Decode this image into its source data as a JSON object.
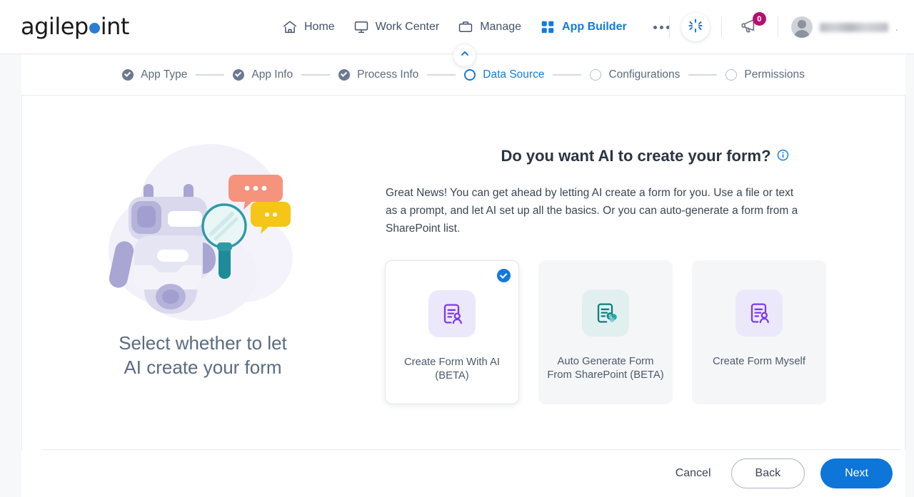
{
  "brand": {
    "name_part1": "agilep",
    "dot": "o",
    "name_part2": "int"
  },
  "nav": {
    "items": [
      {
        "label": "Home",
        "icon": "home-icon",
        "active": false
      },
      {
        "label": "Work Center",
        "icon": "monitor-icon",
        "active": false
      },
      {
        "label": "Manage",
        "icon": "briefcase-icon",
        "active": false
      },
      {
        "label": "App Builder",
        "icon": "grid-icon",
        "active": true
      }
    ],
    "overflow_icon": "ellipsis-icon"
  },
  "header_right": {
    "ai_icon": "ai-pinwheel-icon",
    "announcements_icon": "megaphone-icon",
    "announcements_count": "0",
    "avatar_icon": "avatar-icon",
    "user_name": "",
    "user_name_redacted": true,
    "caret": "."
  },
  "collapse_toggle": {
    "icon": "chevron-up-icon"
  },
  "stepper": {
    "steps": [
      {
        "label": "App Type",
        "state": "done"
      },
      {
        "label": "App Info",
        "state": "done"
      },
      {
        "label": "Process Info",
        "state": "done"
      },
      {
        "label": "Data Source",
        "state": "active"
      },
      {
        "label": "Configurations",
        "state": "todo"
      },
      {
        "label": "Permissions",
        "state": "todo"
      }
    ]
  },
  "left_panel": {
    "illustration": "robot-with-magnifier-illustration",
    "caption_line1": "Select whether to let",
    "caption_line2": "AI create your form"
  },
  "main": {
    "title": "Do you want AI to create your form?",
    "info_icon": "info-icon",
    "description": "Great News! You can get ahead by letting AI create a form for you. Use a file or text as a prompt, and let AI set up all the basics. Or you can auto-generate a form from a SharePoint list.",
    "options": [
      {
        "label_line1": "Create Form With AI",
        "label_line2": "(BETA)",
        "icon": "form-person-purple-icon",
        "selected": true
      },
      {
        "label_line1": "Auto Generate Form",
        "label_line2": "From SharePoint (BETA)",
        "icon": "form-sharepoint-teal-icon",
        "selected": false
      },
      {
        "label_line1": "Create Form Myself",
        "label_line2": "",
        "icon": "form-person-purple-icon",
        "selected": false
      }
    ]
  },
  "footer": {
    "cancel_label": "Cancel",
    "back_label": "Back",
    "next_label": "Next"
  },
  "colors": {
    "accent_blue": "#127ade",
    "next_button": "#0e76d9",
    "badge_magenta": "#b5106f",
    "icon_purple": "#7c3aed",
    "icon_teal": "#0f7d7d",
    "text_slate": "#5a6b81"
  }
}
